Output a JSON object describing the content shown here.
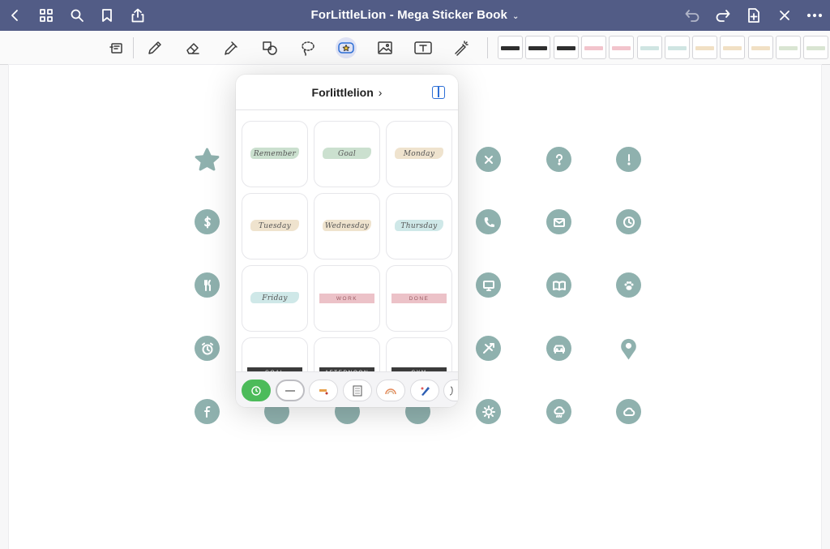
{
  "app": {
    "title": "ForLittleLion - Mega Sticker Book",
    "title_chevron": "⌄",
    "accent": "#525c86"
  },
  "titlebar_left": [
    "back-icon",
    "grid-icon",
    "search-icon",
    "bookmark-icon",
    "share-icon"
  ],
  "titlebar_right": [
    "undo-icon",
    "redo-icon",
    "add-page-icon",
    "close-icon",
    "more-icon"
  ],
  "toolbar": {
    "tools": [
      "reader-icon",
      "pen-icon",
      "eraser-icon",
      "highlighter-icon",
      "shapes-icon",
      "lasso-icon",
      "sticker-icon",
      "image-icon",
      "text-icon",
      "laser-icon"
    ],
    "selected_tool": "sticker-icon"
  },
  "swatches": [
    {
      "color": "#2f2f2f"
    },
    {
      "color": "#2f2f2f"
    },
    {
      "color": "#2f2f2f"
    },
    {
      "color": "#f2c4cc"
    },
    {
      "color": "#f2c4cc"
    },
    {
      "color": "#cfe5e2"
    },
    {
      "color": "#cfe5e2"
    },
    {
      "color": "#f1e0c4"
    },
    {
      "color": "#f1e0c4"
    },
    {
      "color": "#f1e0c4"
    },
    {
      "color": "#d9e5d2"
    },
    {
      "color": "#d9e5d2"
    }
  ],
  "page_icons": [
    "star-icon",
    "x-circle-icon",
    "question-icon",
    "exclamation-icon",
    "dollar-icon",
    "phone-icon",
    "mail-icon",
    "clock-icon",
    "utensils-icon",
    "monitor-icon",
    "book-icon",
    "paw-icon",
    "alarm-icon",
    "plane-icon",
    "car-icon",
    "pin-icon",
    "facebook-icon",
    "sun-icon",
    "cloud-rain-icon",
    "cloud-icon"
  ],
  "icon_color": "#8fb1ae",
  "popover": {
    "title": "Forlittlelion",
    "title_arrow": "›",
    "stickers": [
      {
        "text": "Remember",
        "style": "script",
        "color": "#b9d6bf"
      },
      {
        "text": "Goal",
        "style": "script",
        "color": "#b9d6bf"
      },
      {
        "text": "Monday",
        "style": "script",
        "color": "#ead9bd"
      },
      {
        "text": "Tuesday",
        "style": "script",
        "color": "#ead9bd"
      },
      {
        "text": "Wednesday",
        "style": "script",
        "color": "#ead9bd"
      },
      {
        "text": "Thursday",
        "style": "script",
        "color": "#bfe0e0"
      },
      {
        "text": "Friday",
        "style": "script",
        "color": "#bfe0e0"
      },
      {
        "text": "WORK",
        "style": "tag",
        "color": "#ecc2c8"
      },
      {
        "text": "DONE",
        "style": "tag",
        "color": "#ecc2c8"
      },
      {
        "text": "GOAL",
        "style": "dark",
        "color": "#3b3b3b"
      },
      {
        "text": "AFTERNOON",
        "style": "dark",
        "color": "#3b3b3b"
      },
      {
        "text": "GYM",
        "style": "dark",
        "color": "#3b3b3b"
      }
    ],
    "tray": [
      "recent-icon",
      "washi-icon",
      "label-icon",
      "notepad-icon",
      "rainbow-icon",
      "pen-sticker-icon",
      "script-icon"
    ]
  }
}
